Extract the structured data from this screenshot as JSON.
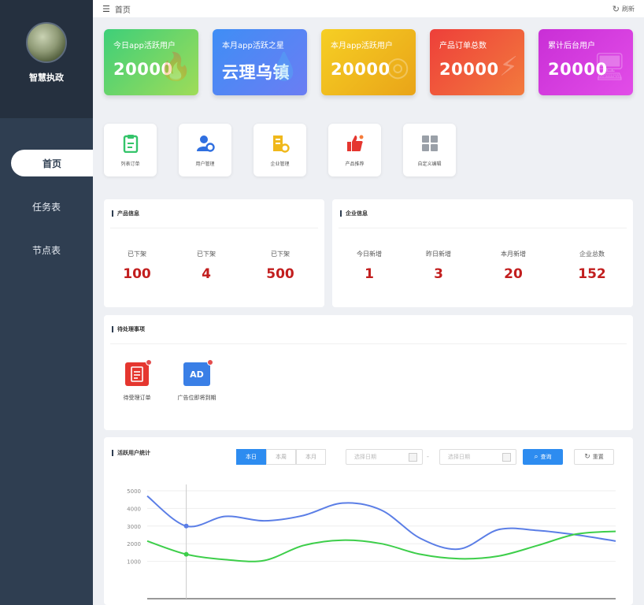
{
  "profile": {
    "name": "智慧执政"
  },
  "sidebar": {
    "items": [
      {
        "label": "首页"
      },
      {
        "label": "任务表"
      },
      {
        "label": "节点表"
      }
    ]
  },
  "topbar": {
    "breadcrumb": "首页",
    "refresh_label": "刷新",
    "menu_icon": "menu-icon",
    "refresh_icon": "refresh-icon"
  },
  "stats": [
    {
      "title": "今日app活跃用户",
      "value": "20000",
      "color_from": "#3ecf79",
      "color_to": "#9fdc58",
      "icon": "flame-icon"
    },
    {
      "title": "本月app活跃之星",
      "value": "云理乌镇",
      "color_from": "#3f8ef5",
      "color_to": "#6b7df3",
      "icon": "drop-icon"
    },
    {
      "title": "本月app活跃用户",
      "value": "20000",
      "color_from": "#f6cf24",
      "color_to": "#e9a418",
      "icon": "coin-icon"
    },
    {
      "title": "产品订单总数",
      "value": "20000",
      "color_from": "#ee3f3a",
      "color_to": "#f27a3d",
      "icon": "lightning-icon"
    },
    {
      "title": "累计后台用户",
      "value": "20000",
      "color_from": "#c92fd6",
      "color_to": "#e24de8",
      "icon": "monitor-icon"
    }
  ],
  "quick": [
    {
      "label": "列表订单",
      "icon": "clipboard-icon"
    },
    {
      "label": "用户管理",
      "icon": "user-gear-icon"
    },
    {
      "label": "企业管理",
      "icon": "building-gear-icon"
    },
    {
      "label": "产品推荐",
      "icon": "thumbs-up-icon"
    },
    {
      "label": "自定义编辑",
      "icon": "grid-icon"
    }
  ],
  "product_panel": {
    "title": "产品信息",
    "items": [
      {
        "label": "已下架",
        "value": "100"
      },
      {
        "label": "已下架",
        "value": "4"
      },
      {
        "label": "已下架",
        "value": "500"
      }
    ]
  },
  "company_panel": {
    "title": "企业信息",
    "items": [
      {
        "label": "今日新增",
        "value": "1"
      },
      {
        "label": "昨日新增",
        "value": "3"
      },
      {
        "label": "本月新增",
        "value": "20"
      },
      {
        "label": "企业总数",
        "value": "152"
      }
    ]
  },
  "todo_panel": {
    "title": "待处理事项",
    "items": [
      {
        "label": "待受理订单",
        "icon": "document-icon"
      },
      {
        "label": "广告位即将到期",
        "icon": "ad-icon",
        "icon_text": "AD"
      }
    ]
  },
  "chart_panel": {
    "title": "活跃用户统计",
    "segments": [
      {
        "label": "本日"
      },
      {
        "label": "本周"
      },
      {
        "label": "本月"
      }
    ],
    "start_placeholder": "选择日期",
    "end_placeholder": "选择日期",
    "dash": "-",
    "query_label": "查询",
    "reset_label": "重置"
  },
  "chart_data": {
    "type": "line",
    "y_ticks": [
      "5000",
      "4000",
      "3000",
      "2000",
      "1000"
    ],
    "ylim": [
      0,
      5000
    ],
    "grid": true,
    "x": [
      0,
      1,
      2,
      3,
      4,
      5,
      6,
      7,
      8,
      9,
      10,
      11,
      12
    ],
    "series": [
      {
        "color": "#5b7ee6",
        "values": [
          4700,
          3000,
          3550,
          3300,
          3600,
          4300,
          3900,
          2300,
          1700,
          2800,
          2750,
          2500,
          2150
        ]
      },
      {
        "color": "#3dce4a",
        "values": [
          2150,
          1400,
          1100,
          1050,
          1900,
          2200,
          2000,
          1400,
          1150,
          1300,
          1900,
          2550,
          2700
        ]
      }
    ],
    "highlight_index": 1
  }
}
